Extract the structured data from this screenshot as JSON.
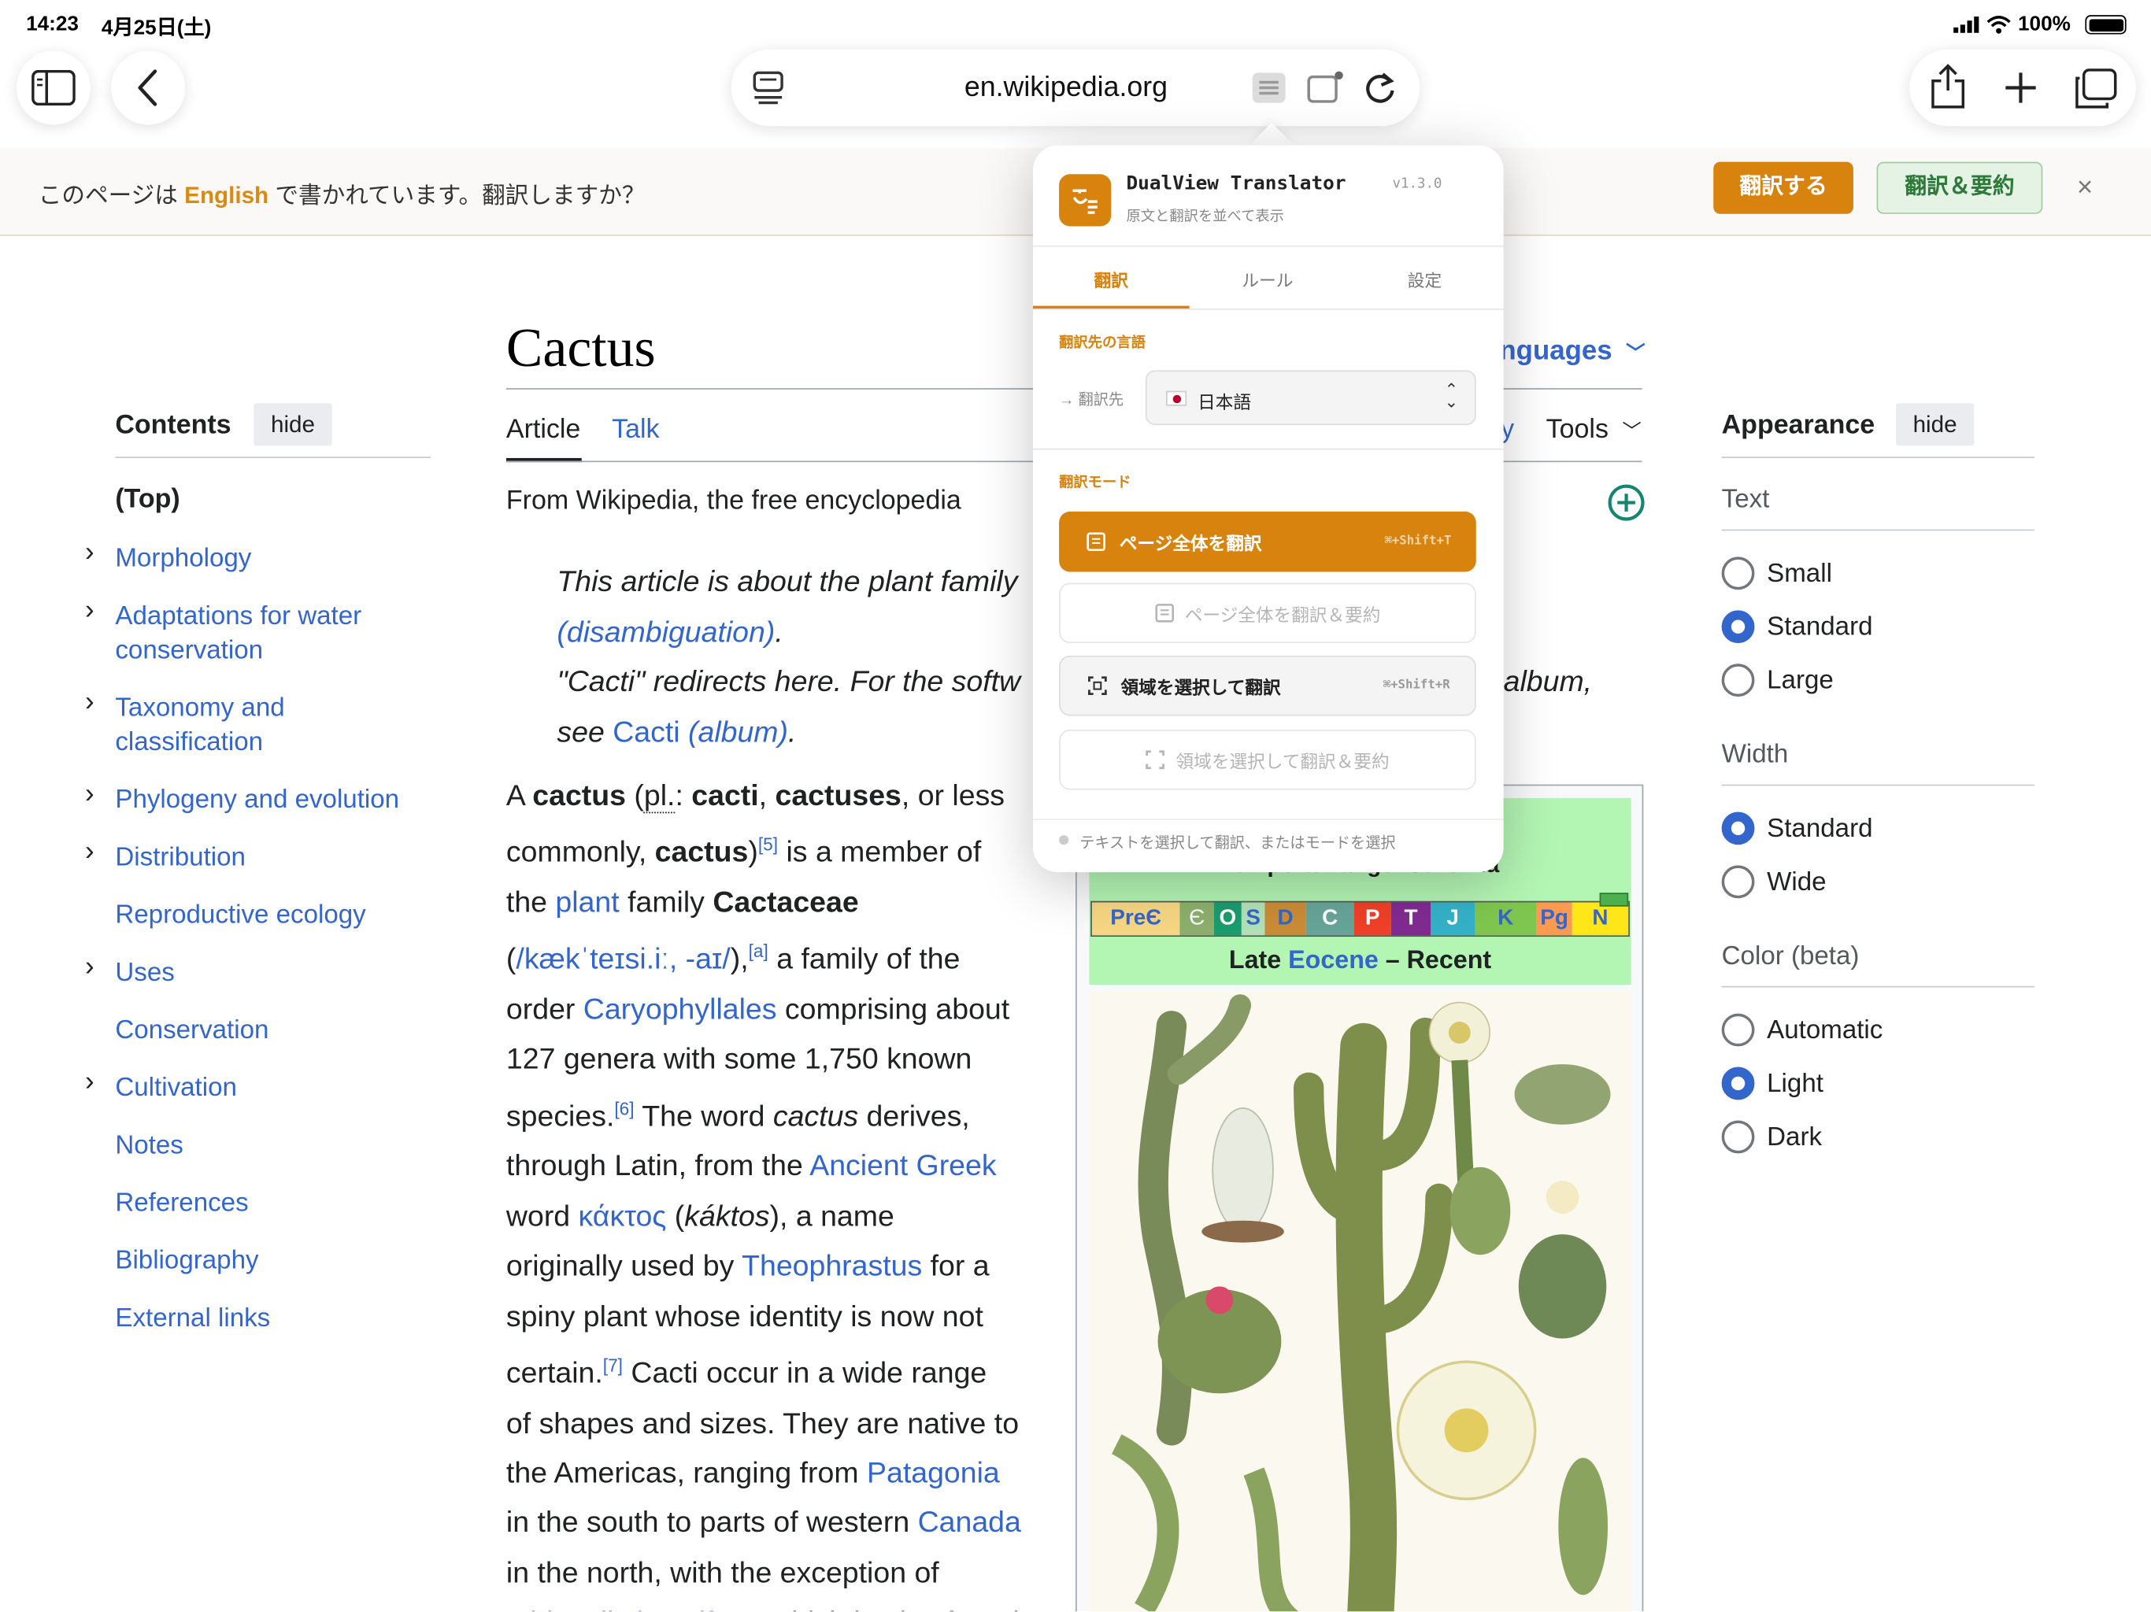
{
  "status_bar": {
    "time": "14:23",
    "date": "4月25日(土)",
    "battery": "100%"
  },
  "toolbar": {
    "url": "en.wikipedia.org"
  },
  "translate_bar": {
    "prefix": "このページは",
    "language": "English",
    "suffix": "で書かれています。翻訳しますか？",
    "translate_button": "翻訳する",
    "translate_summary_button": "翻訳＆要約",
    "close": "×"
  },
  "popup": {
    "name": "DualView Translator",
    "version": "v1.3.0",
    "subtitle": "原文と翻訳を並べて表示",
    "tabs": [
      "翻訳",
      "ルール",
      "設定"
    ],
    "target_section": "翻訳先の言語",
    "target_label": "→ 翻訳先",
    "target_value": "日本語",
    "mode_section": "翻訳モード",
    "modes": [
      {
        "label": "ページ全体を翻訳",
        "shortcut": "⌘+Shift+T"
      },
      {
        "label": "ページ全体を翻訳＆要約",
        "shortcut": ""
      },
      {
        "label": "領域を選択して翻訳",
        "shortcut": "⌘+Shift+R"
      },
      {
        "label": "領域を選択して翻訳＆要約",
        "shortcut": ""
      }
    ],
    "footer": "テキストを選択して翻訳、またはモードを選択"
  },
  "wiki": {
    "title": "Cactus",
    "languages": "nguages",
    "tabs": {
      "article": "Article",
      "talk": "Talk",
      "tools": "Tools",
      "y": "y"
    },
    "from": "From Wikipedia, the free encyclopedia",
    "toc": {
      "title": "Contents",
      "hide": "hide",
      "top": "(Top)",
      "items": [
        "Morphology",
        "Adaptations for water",
        "conservation",
        "Taxonomy and",
        "classification",
        "Phylogeny and evolution",
        "Distribution",
        "Reproductive ecology",
        "Uses",
        "Conservation",
        "Cultivation",
        "Notes",
        "References",
        "Bibliography",
        "External links"
      ]
    },
    "hatnote": {
      "l1": "This article is about the plant family",
      "l2": "(disambiguation)",
      "l3a": "\"Cacti\" redirects here. For the softw",
      "l3b": "album,",
      "l4a": "see",
      "l4b": "Cacti",
      "l4c": "(album)"
    },
    "infobox": {
      "range": "Temporal range: 35–0 Ma",
      "periods": [
        "PreЄ",
        "Є",
        "O",
        "S",
        "D",
        "C",
        "P",
        "T",
        "J",
        "K",
        "Pg",
        "N"
      ],
      "late": "Late",
      "eocene": "Eocene",
      "recent": "– Recent"
    },
    "appearance": {
      "title": "Appearance",
      "hide": "hide",
      "text_head": "Text",
      "text_opts": [
        "Small",
        "Standard",
        "Large"
      ],
      "width_head": "Width",
      "width_opts": [
        "Standard",
        "Wide"
      ],
      "color_head": "Color (beta)",
      "color_opts": [
        "Automatic",
        "Light",
        "Dark"
      ]
    }
  }
}
